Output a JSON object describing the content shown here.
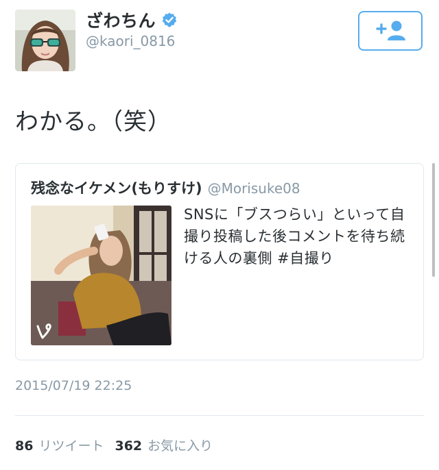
{
  "author": {
    "display_name": "ざわちん",
    "handle": "@kaori_0816",
    "verified": true,
    "avatar_icon": "avatar-photo"
  },
  "follow_button": {
    "icon": "add-user-icon",
    "accent": "#55acee"
  },
  "tweet": {
    "text": "わかる。（笑）",
    "timestamp": "2015/07/19 22:25"
  },
  "quoted_tweet": {
    "display_name": "残念なイケメン(もりすけ)",
    "handle": "@Morisuke08",
    "text": "SNSに「ブスつらい」といって自撮り投稿した後コメントを待ち続ける人の裏側 #自撮り",
    "media_icon": "vine-icon"
  },
  "stats": {
    "retweet_count": "86",
    "retweet_label": "リツイート",
    "favorite_count": "362",
    "favorite_label": "お気に入り"
  },
  "colors": {
    "primary_text": "#292f33",
    "secondary_text": "#8899a6",
    "border": "#e1e8ed",
    "verified": "#55acee"
  }
}
